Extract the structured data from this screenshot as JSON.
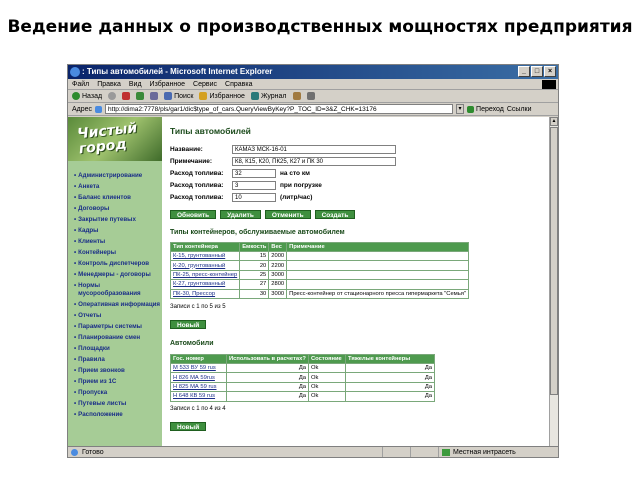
{
  "slide": {
    "title": "Ведение данных о производственных мощностях предприятия"
  },
  "window": {
    "title": ": Типы автомобилей - Microsoft Internet Explorer",
    "controls": [
      "_",
      "□",
      "×"
    ]
  },
  "menubar": [
    "Файл",
    "Правка",
    "Вид",
    "Избранное",
    "Сервис",
    "Справка"
  ],
  "toolbar": {
    "back": "Назад",
    "search": "Поиск",
    "favorites": "Избранное",
    "journal": "Журнал"
  },
  "addressbar": {
    "label": "Адрес",
    "url": "http://dima2:7778/pls/gar1/dic$type_of_cars.QueryViewByKey?P_TOC_ID=3&Z_CHK=13176",
    "go": "Переход",
    "links": "Ссылки"
  },
  "statusbar": {
    "left": "Готово",
    "zone": "Местная интрасеть"
  },
  "sidebar": {
    "logo": "Чистый город",
    "items": [
      "Администрирование",
      "Анкета",
      "Баланс клиентов",
      "Договоры",
      "Закрытие путевых",
      "Кадры",
      "Клиенты",
      "Контейнеры",
      "Контроль диспетчеров",
      "Менеджеры - договоры",
      "Нормы мусорообразования",
      "Оперативная информация",
      "Отчеты",
      "Параметры системы",
      "Планирование смен",
      "Площадки",
      "Правила",
      "Прием звонков",
      "Прием из 1С",
      "Пропуска",
      "Путевые листы",
      "Расположение"
    ]
  },
  "content": {
    "page_title": "Типы автомобилей",
    "form": {
      "name_label": "Название:",
      "name_value": "КАМАЗ МСК-16-01",
      "note_label": "Примечание:",
      "note_value": "К8, К15, К20, ПК25, К27 и ПК 30",
      "fuel1_label": "Расход топлива:",
      "fuel1_value": "32",
      "fuel1_unit": "на сто км",
      "fuel2_label": "Расход топлива:",
      "fuel2_value": "3",
      "fuel2_unit": "при погрузке",
      "fuel3_label": "Расход топлива:",
      "fuel3_value": "10",
      "fuel3_unit": "(литр/час)"
    },
    "buttons": {
      "update": "Обновить",
      "delete": "Удалить",
      "cancel": "Отменить",
      "create": "Создать"
    },
    "containers": {
      "heading": "Типы контейнеров, обслуживаемые автомобилем",
      "headers": [
        "Тип контейнера",
        "Емкость",
        "Вес",
        "Примечание"
      ],
      "rows": [
        [
          "К-15, грунтованный",
          "15",
          "2000",
          ""
        ],
        [
          "К-20, грунтованный",
          "20",
          "2200",
          ""
        ],
        [
          "ПК-25, пресс-контейнер",
          "25",
          "3000",
          ""
        ],
        [
          "К-27, грунтованный",
          "27",
          "2800",
          ""
        ],
        [
          "ПК-30, Прессор",
          "30",
          "3000",
          "Пресс-контейнер от стационарного пресса гипермаркета \"Семья\""
        ]
      ],
      "records": "Записи с 1 по 5 из 5",
      "new_button": "Новый"
    },
    "cars": {
      "heading": "Автомобили",
      "headers": [
        "Гос. номер",
        "Использовать в расчетах?",
        "Состояние",
        "Тяжелые контейнеры"
      ],
      "rows": [
        [
          "М 533 ВУ 59 rus",
          "Да",
          "Ok",
          "Да"
        ],
        [
          "Н 826 МА 59rus",
          "Да",
          "Ok",
          "Да"
        ],
        [
          "Н 825 МА 59 rus",
          "Да",
          "Ok",
          "Да"
        ],
        [
          "Н 648 КВ 59 rus",
          "Да",
          "Ok",
          "Да"
        ]
      ],
      "records": "Записи с 1 по 4 из 4",
      "new_button": "Новый"
    }
  }
}
